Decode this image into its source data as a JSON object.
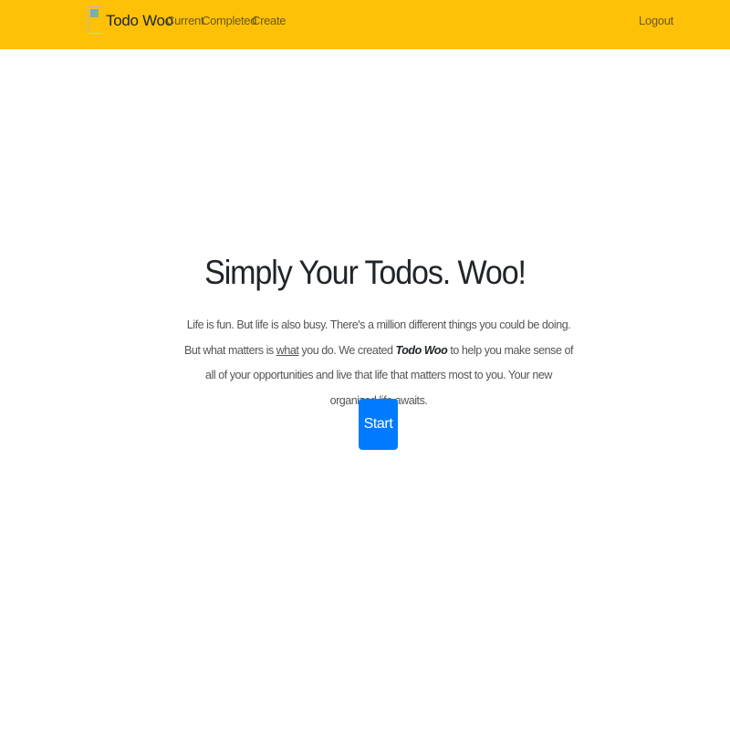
{
  "navbar": {
    "brand": "Todo Woo",
    "brand_logo_icon": "broken-image-icon",
    "links": [
      "Current",
      "Completed",
      "Create"
    ],
    "logout": "Logout",
    "background_color": "#ffc107"
  },
  "hero": {
    "title": "Simply Your Todos. Woo!",
    "text_part1": "Life is fun. But life is also busy. There's a million different things you could be doing. But what matters is ",
    "text_underlined": "what",
    "text_part2": " you do. We created ",
    "text_bold_italic": "Todo Woo",
    "text_part3": " to help you make sense of all of your opportunities and live that life that matters most to you. Your new organized life awaits.",
    "start_button": "Start",
    "button_color": "#007bff"
  }
}
